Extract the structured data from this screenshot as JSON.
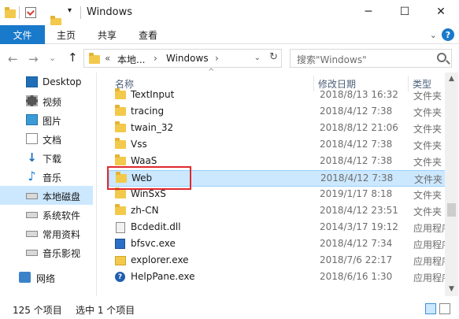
{
  "window": {
    "title": "Windows",
    "minimize_glyph": "─",
    "maximize_glyph": "☐",
    "close_glyph": "✕"
  },
  "ribbon": {
    "tabs": [
      "文件",
      "主页",
      "共享",
      "查看"
    ],
    "expand_glyph": "⌄",
    "help_glyph": "?"
  },
  "nav": {
    "back_glyph": "←",
    "forward_glyph": "→",
    "dropdown_glyph": "⌄",
    "up_glyph": "↑"
  },
  "address": {
    "overflow": "«",
    "crumbs": [
      "本地...",
      "Windows"
    ],
    "separator": "›",
    "dropdown_glyph": "⌄",
    "refresh_glyph": "↻"
  },
  "search": {
    "placeholder": "搜索\"Windows\""
  },
  "sidebar": {
    "items": [
      {
        "label": "Desktop",
        "icon": "desktop-icon"
      },
      {
        "label": "视频",
        "icon": "video-icon"
      },
      {
        "label": "图片",
        "icon": "pictures-icon"
      },
      {
        "label": "文档",
        "icon": "documents-icon"
      },
      {
        "label": "下载",
        "icon": "download-icon"
      },
      {
        "label": "音乐",
        "icon": "music-icon"
      },
      {
        "label": "本地磁盘",
        "icon": "drive-icon",
        "selected": true
      },
      {
        "label": "系统软件",
        "icon": "drive-icon"
      },
      {
        "label": "常用资料",
        "icon": "drive-icon"
      },
      {
        "label": "音乐影视",
        "icon": "drive-icon"
      },
      {
        "label": "网络",
        "icon": "network-icon"
      }
    ]
  },
  "columns": {
    "name": "名称",
    "date": "修改日期",
    "type": "类型",
    "sort_glyph": "^"
  },
  "files": [
    {
      "name": "TextInput",
      "date": "2018/8/13 16:32",
      "type": "文件夹",
      "icon": "folder-icon"
    },
    {
      "name": "tracing",
      "date": "2018/4/12 7:38",
      "type": "文件夹",
      "icon": "folder-icon"
    },
    {
      "name": "twain_32",
      "date": "2018/8/12 21:06",
      "type": "文件夹",
      "icon": "folder-icon"
    },
    {
      "name": "Vss",
      "date": "2018/4/12 7:38",
      "type": "文件夹",
      "icon": "folder-icon"
    },
    {
      "name": "WaaS",
      "date": "2018/4/12 7:38",
      "type": "文件夹",
      "icon": "folder-icon"
    },
    {
      "name": "Web",
      "date": "2018/4/12 7:38",
      "type": "文件夹",
      "icon": "folder-icon",
      "selected": true
    },
    {
      "name": "WinSxS",
      "date": "2019/1/17 8:18",
      "type": "文件夹",
      "icon": "folder-icon"
    },
    {
      "name": "zh-CN",
      "date": "2018/4/12 23:51",
      "type": "文件夹",
      "icon": "folder-icon"
    },
    {
      "name": "Bcdedit.dll",
      "date": "2014/3/17 19:12",
      "type": "应用程序",
      "icon": "dll-icon"
    },
    {
      "name": "bfsvc.exe",
      "date": "2018/4/12 7:34",
      "type": "应用程序",
      "icon": "exe-icon"
    },
    {
      "name": "explorer.exe",
      "date": "2018/7/6 22:17",
      "type": "应用程序",
      "icon": "explorer-icon"
    },
    {
      "name": "HelpPane.exe",
      "date": "2018/6/16 1:30",
      "type": "应用程序",
      "icon": "help-icon"
    }
  ],
  "statusbar": {
    "count": "125 个项目",
    "selected": "选中 1 个项目"
  }
}
